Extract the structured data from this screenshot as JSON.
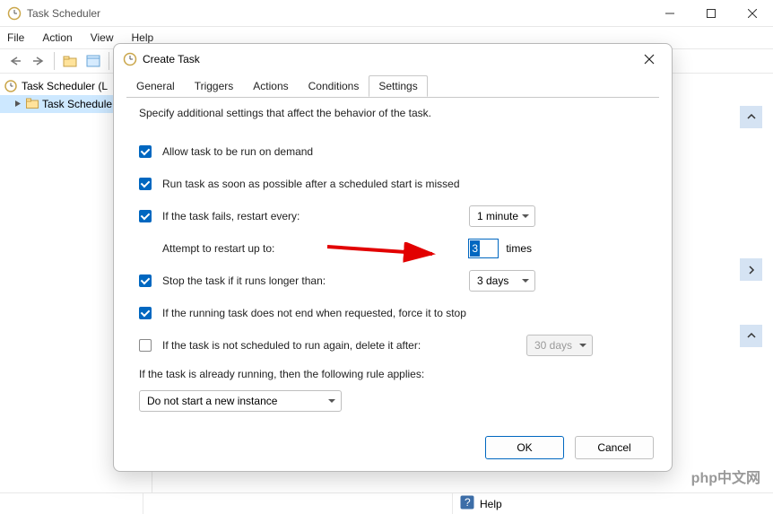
{
  "window": {
    "title": "Task Scheduler",
    "menu": [
      "File",
      "Action",
      "View",
      "Help"
    ]
  },
  "tree": {
    "root": "Task Scheduler (L",
    "child": "Task Schedule"
  },
  "statusbar": {
    "help": "Help"
  },
  "watermark": "php中文网",
  "dialog": {
    "title": "Create Task",
    "tabs": [
      "General",
      "Triggers",
      "Actions",
      "Conditions",
      "Settings"
    ],
    "active_tab": "Settings",
    "description": "Specify additional settings that affect the behavior of the task.",
    "settings": {
      "allow_on_demand": {
        "label": "Allow task to be run on demand",
        "checked": true
      },
      "run_asap": {
        "label": "Run task as soon as possible after a scheduled start is missed",
        "checked": true
      },
      "restart": {
        "label": "If the task fails, restart every:",
        "checked": true,
        "interval": "1 minute",
        "attempt_label": "Attempt to restart up to:",
        "attempt_value": "3",
        "attempt_suffix": "times"
      },
      "stop_longer": {
        "label": "Stop the task if it runs longer than:",
        "checked": true,
        "value": "3 days"
      },
      "force_stop": {
        "label": "If the running task does not end when requested, force it to stop",
        "checked": true
      },
      "delete_after": {
        "label": "If the task is not scheduled to run again, delete it after:",
        "checked": false,
        "value": "30 days"
      },
      "rule_label": "If the task is already running, then the following rule applies:",
      "rule_value": "Do not start a new instance"
    },
    "buttons": {
      "ok": "OK",
      "cancel": "Cancel"
    }
  }
}
